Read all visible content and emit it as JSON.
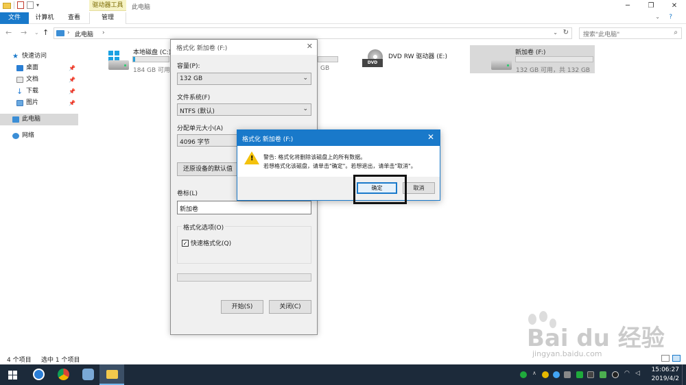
{
  "window": {
    "context_tab": "驱动器工具",
    "title": "此电脑",
    "ribbon_tabs": [
      "文件",
      "计算机",
      "查看",
      "管理"
    ]
  },
  "address": {
    "path": "此电脑",
    "search_placeholder": "搜索\"此电脑\""
  },
  "nav": {
    "quick_access": "快速访问",
    "desktop": "桌面",
    "documents": "文档",
    "downloads": "下载",
    "pictures": "图片",
    "this_pc": "此电脑",
    "network": "网络"
  },
  "drives": [
    {
      "name": "本地磁盘 (C:)",
      "info": "184 GB 可用,",
      "used_fraction": 0.06
    },
    {
      "name": "",
      "info": "GB",
      "used_fraction": 0.0
    },
    {
      "name": "DVD RW 驱动器 (E:)",
      "info": "",
      "used_fraction": 0.0
    },
    {
      "name": "新加卷 (F:)",
      "info": "132 GB 可用，共 132 GB",
      "used_fraction": 0.0
    }
  ],
  "status": {
    "count": "4 个项目",
    "selected": "选中 1 个项目"
  },
  "format_dialog": {
    "title": "格式化 新加卷 (F:)",
    "capacity_label": "容量(P):",
    "capacity_value": "132 GB",
    "fs_label": "文件系统(F)",
    "fs_value": "NTFS (默认)",
    "alloc_label": "分配单元大小(A)",
    "alloc_value": "4096 字节",
    "restore_button": "还原设备的默认值",
    "volume_label": "卷标(L)",
    "volume_value": "新加卷",
    "options_label": "格式化选项(O)",
    "quick_format": "快速格式化(Q)",
    "start_button": "开始(S)",
    "close_button": "关闭(C)"
  },
  "warning_dialog": {
    "title": "格式化 新加卷 (F:)",
    "line1": "警告: 格式化将删除该磁盘上的所有数据。",
    "line2": "若想格式化该磁盘，请单击\"确定\"。若想退出，请单击\"取消\"。",
    "ok_button": "确定",
    "cancel_button": "取消"
  },
  "taskbar": {
    "time": "15:06:27",
    "date": "2019/4/2"
  },
  "watermark": {
    "brand": "Bai du 经验",
    "url": "jingyan.baidu.com"
  },
  "colors": {
    "accent": "#1979ca",
    "taskbar": "#1c2a3a",
    "drive_fill": "#26a0da",
    "warning_icon": "#f4c20d"
  }
}
